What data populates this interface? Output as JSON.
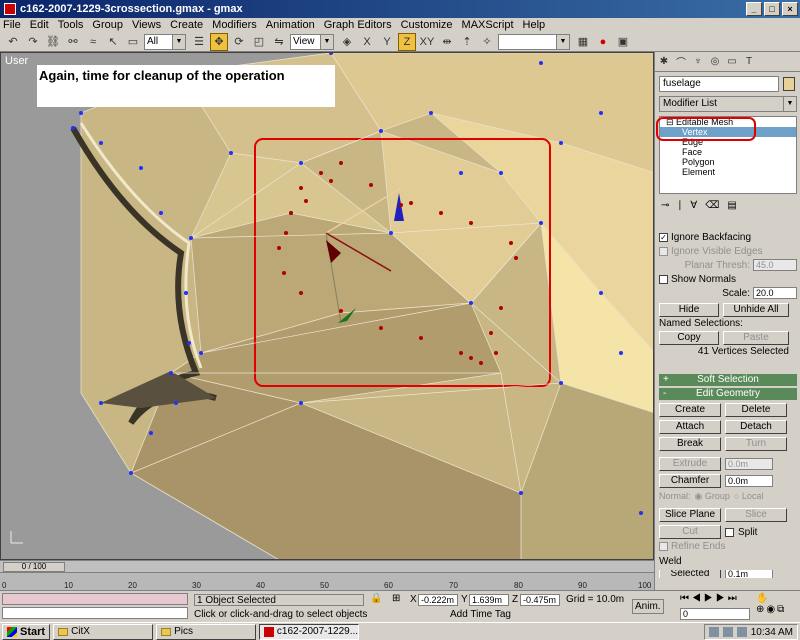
{
  "window": {
    "title": "c162-2007-1229-3crossection.gmax - gmax",
    "min_label": "_",
    "max_label": "□",
    "close_label": "×"
  },
  "menu": [
    "File",
    "Edit",
    "Tools",
    "Group",
    "Views",
    "Create",
    "Modifiers",
    "Animation",
    "Graph Editors",
    "Customize",
    "MAXScript",
    "Help"
  ],
  "toolbar": {
    "filter_select": "All",
    "coord_select": "View"
  },
  "viewport": {
    "label": "User",
    "note": "Again, time for cleanup of the operation"
  },
  "command_panel": {
    "object_name": "fuselage",
    "modifier_list": "Modifier List",
    "stack": {
      "root": "Editable Mesh",
      "items": [
        "Vertex",
        "Edge",
        "Face",
        "Polygon",
        "Element"
      ],
      "selected_index": 0
    },
    "selection": {
      "ignore_backfacing": "Ignore Backfacing",
      "ignore_visible_edges": "Ignore Visible Edges",
      "planar_thresh_label": "Planar Thresh:",
      "planar_thresh_value": "45.0",
      "show_normals": "Show Normals",
      "scale_label": "Scale:",
      "scale_value": "20.0",
      "hide": "Hide",
      "unhide_all": "Unhide All",
      "named_selections": "Named Selections:",
      "copy": "Copy",
      "paste": "Paste",
      "count_text": "41 Vertices Selected"
    },
    "soft_selection": "Soft Selection",
    "edit_geometry": {
      "title": "Edit Geometry",
      "create": "Create",
      "delete": "Delete",
      "attach": "Attach",
      "detach": "Detach",
      "break": "Break",
      "turn": "Turn",
      "extrude": "Extrude",
      "extrude_value": "0.0m",
      "chamfer": "Chamfer",
      "chamfer_value": "0.0m",
      "normal_label": "Normal:",
      "group": "Group",
      "local": "Local",
      "slice_plane": "Slice Plane",
      "slice": "Slice",
      "cut": "Cut",
      "split": "Split",
      "refine_ends": "Refine Ends",
      "weld": "Weld",
      "selected": "Selected",
      "selected_value": "0.1m"
    }
  },
  "timeline": {
    "slider_text": "0 / 100",
    "ticks": [
      "0",
      "10",
      "20",
      "30",
      "40",
      "50",
      "60",
      "70",
      "80",
      "90",
      "100"
    ]
  },
  "status": {
    "objects_selected": "1 Object Selected",
    "prompt": "Click or click-and-drag to select objects",
    "x_label": "X",
    "x_value": "-0.222m",
    "y_label": "Y",
    "y_value": "1.639m",
    "z_label": "Z",
    "z_value": "-0.475m",
    "grid": "Grid = 10.0m",
    "add_time_tag": "Add Time Tag",
    "anim": "Anim.",
    "frame": "0"
  },
  "taskbar": {
    "start": "Start",
    "tasks": [
      "CitX",
      "Pics",
      "c162-2007-1229..."
    ],
    "active_index": 2,
    "clock": "10:34 AM"
  },
  "colors": {
    "mesh_fill": "#cdbb88",
    "selection_box": "#e00000",
    "vertex_blue": "#2030ff",
    "vertex_red": "#b00000"
  }
}
